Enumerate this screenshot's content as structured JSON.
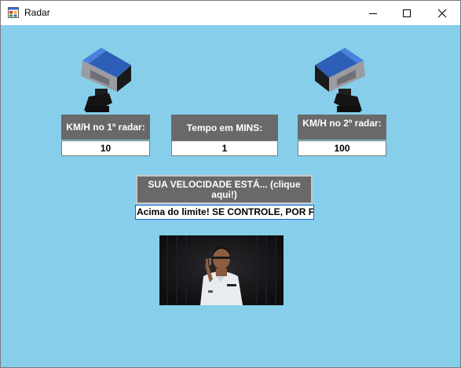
{
  "window": {
    "title": "Radar"
  },
  "radar1": {
    "label": "KM/H no 1º radar:",
    "value": "10"
  },
  "time": {
    "label": "Tempo em MINS:",
    "value": "1"
  },
  "radar2": {
    "label": "KM/H no 2º radar:",
    "value": "100"
  },
  "result": {
    "button_label": "SUA VELOCIDADE ESTÁ... (clique aqui!)",
    "text": "Acima do limite! SE CONTROLE, POR FAVOR!"
  },
  "icons": {
    "radar": "speed-camera-icon",
    "app": "application-icon"
  },
  "colors": {
    "background": "#87ceeb",
    "label_bg": "#696969"
  }
}
